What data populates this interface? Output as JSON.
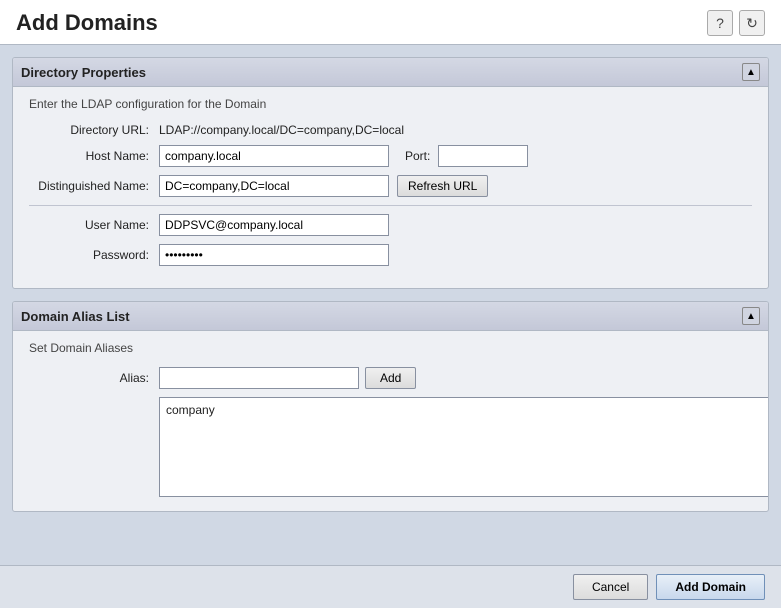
{
  "header": {
    "title": "Add Domains",
    "help_icon": "?",
    "refresh_icon": "↻"
  },
  "directory_properties": {
    "panel_title": "Directory Properties",
    "subtitle": "Enter the LDAP configuration for the Domain",
    "fields": {
      "directory_url_label": "Directory URL:",
      "directory_url_value": "LDAP://company.local/DC=company,DC=local",
      "host_name_label": "Host Name:",
      "host_name_value": "company.local",
      "port_label": "Port:",
      "port_value": "",
      "distinguished_name_label": "Distinguished Name:",
      "distinguished_name_value": "DC=company,DC=local",
      "refresh_url_label": "Refresh URL",
      "user_name_label": "User Name:",
      "user_name_value": "DDPSVC@company.local",
      "password_label": "Password:",
      "password_value": "••••••••"
    }
  },
  "domain_alias_list": {
    "panel_title": "Domain Alias List",
    "subtitle": "Set Domain Aliases",
    "alias_label": "Alias:",
    "alias_input_value": "",
    "alias_input_placeholder": "",
    "add_button_label": "Add",
    "aliases": [
      "company"
    ]
  },
  "footer": {
    "cancel_label": "Cancel",
    "add_domain_label": "Add Domain"
  }
}
